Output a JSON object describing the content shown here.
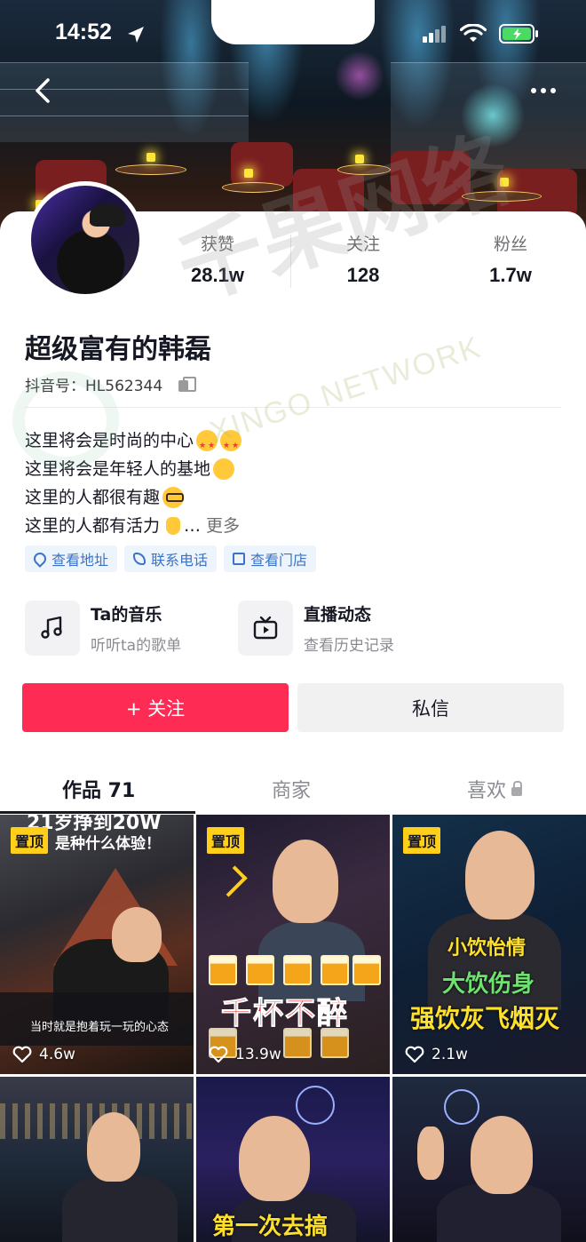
{
  "status_bar": {
    "time": "14:52"
  },
  "profile": {
    "name": "超级富有的韩磊",
    "douyin_id": "抖音号：HL562344",
    "stats": [
      {
        "label": "获赞",
        "value": "28.1w"
      },
      {
        "label": "关注",
        "value": "128"
      },
      {
        "label": "粉丝",
        "value": "1.7w"
      }
    ],
    "bio": [
      "这里将会是时尚的中心",
      "这里将会是年轻人的基地",
      "这里的人都很有趣",
      "这里的人都有活力"
    ],
    "bio_ellipsis": "…",
    "bio_more": "更多",
    "chips": [
      "查看地址",
      "联系电话",
      "查看门店"
    ]
  },
  "features": [
    {
      "title": "Ta的音乐",
      "subtitle": "听听ta的歌单",
      "icon": "music-note-icon"
    },
    {
      "title": "直播动态",
      "subtitle": "查看历史记录",
      "icon": "tv-icon"
    }
  ],
  "actions": {
    "follow": "+ 关注",
    "message": "私信"
  },
  "tabs": [
    {
      "label": "作品 71",
      "active": true
    },
    {
      "label": "商家",
      "active": false
    },
    {
      "label": "喜欢",
      "active": false,
      "locked": true
    }
  ],
  "videos": [
    {
      "pinned": true,
      "pin_label": "置顶",
      "likes": "4.6w",
      "overlay_top": "21岁挣到20W",
      "overlay_top2": "是种什么体验！",
      "caption": "当时就是抱着玩一玩的心态"
    },
    {
      "pinned": true,
      "pin_label": "置顶",
      "likes": "13.9w",
      "overlay_big": "千杯不醉"
    },
    {
      "pinned": true,
      "pin_label": "置顶",
      "likes": "2.1w",
      "overlay_lines": [
        "小饮怡情",
        "大饮伤身",
        "强饮灰飞烟灭"
      ]
    },
    {
      "pinned": false
    },
    {
      "pinned": false,
      "overlay_bottom": "第一次去搞"
    },
    {
      "pinned": false
    }
  ],
  "colors": {
    "accent": "#fe2c55",
    "link": "#3d73c6",
    "pin": "#ffcf1a"
  },
  "watermark": {
    "cn": "千果网络",
    "en": "XINGO NETWORK"
  }
}
